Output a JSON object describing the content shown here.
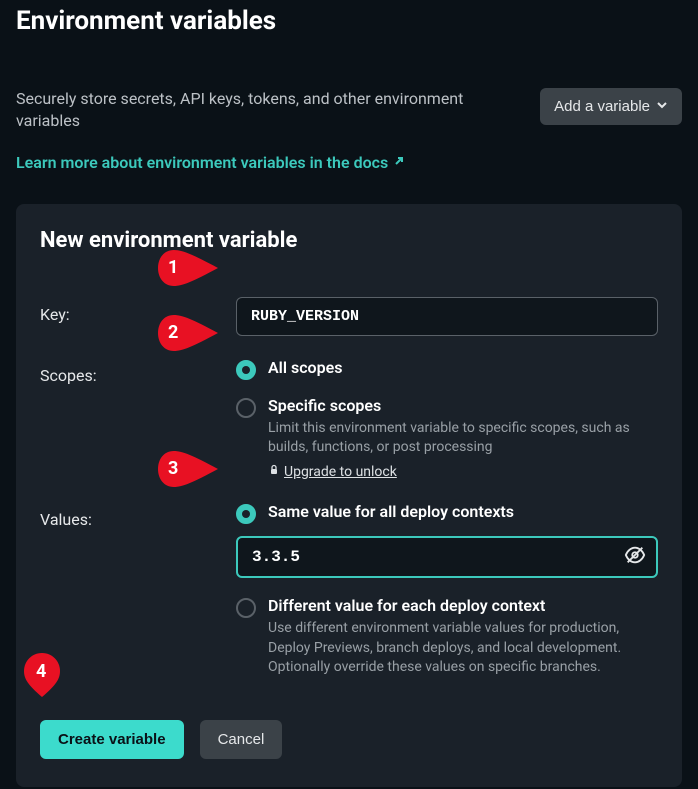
{
  "header": {
    "title": "Environment variables",
    "description": "Securely store secrets, API keys, tokens, and other environment variables",
    "add_button": "Add a variable",
    "docs_link": "Learn more about environment variables in the docs"
  },
  "form": {
    "title": "New environment variable",
    "key_label": "Key:",
    "key_value": "RUBY_VERSION",
    "scopes_label": "Scopes:",
    "scopes": {
      "all": {
        "label": "All scopes",
        "selected": true
      },
      "specific": {
        "label": "Specific scopes",
        "description": "Limit this environment variable to specific scopes, such as builds, functions, or post processing",
        "upgrade": "Upgrade to unlock",
        "selected": false
      }
    },
    "values_label": "Values:",
    "values": {
      "same": {
        "label": "Same value for all deploy contexts",
        "value": "3.3.5",
        "selected": true
      },
      "different": {
        "label": "Different value for each deploy context",
        "description": "Use different environment variable values for production, Deploy Previews, branch deploys, and local development. Optionally override these values on specific branches.",
        "selected": false
      }
    },
    "create_button": "Create variable",
    "cancel_button": "Cancel"
  },
  "callouts": {
    "c1": "1",
    "c2": "2",
    "c3": "3",
    "c4": "4"
  }
}
